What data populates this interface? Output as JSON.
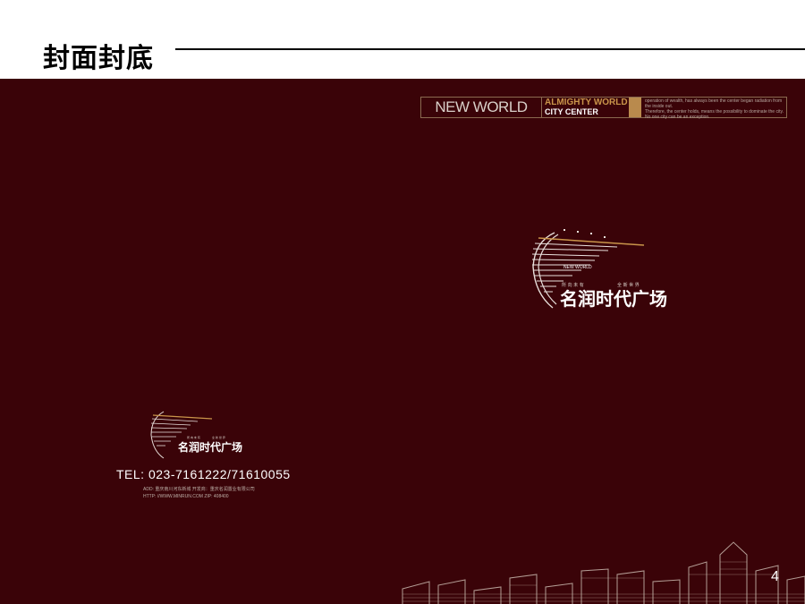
{
  "title": "封面封底",
  "banner": {
    "new_world": "NEW WORLD",
    "almighty": "ALMIGHTY WORLD",
    "city_center": "CITY CENTER",
    "text_line1": "operation of wealth, has always been the center began radiation from the inside out.",
    "text_line2": "Therefore, the center holds, means the possibility to dominate the city.",
    "text_line3": "No one city can be an exception."
  },
  "logo": {
    "tag": "NEW WORLD",
    "slogan_left": "所 向 未 有",
    "slogan_right": "全 新 世 界",
    "name": "名润时代广场"
  },
  "contact": {
    "tel": "TEL: 023-7161222/71610055",
    "addr_line1": "ADD: 重庆南川河东新城 开发商：重庆名润置业有限公司",
    "addr_line2": "HTTP: //WWW.MINRUN.COM   ZIP: 408400"
  },
  "page_number": "4",
  "colors": {
    "background": "#3a0308",
    "gold": "#c9954a",
    "text": "#ffffff"
  }
}
